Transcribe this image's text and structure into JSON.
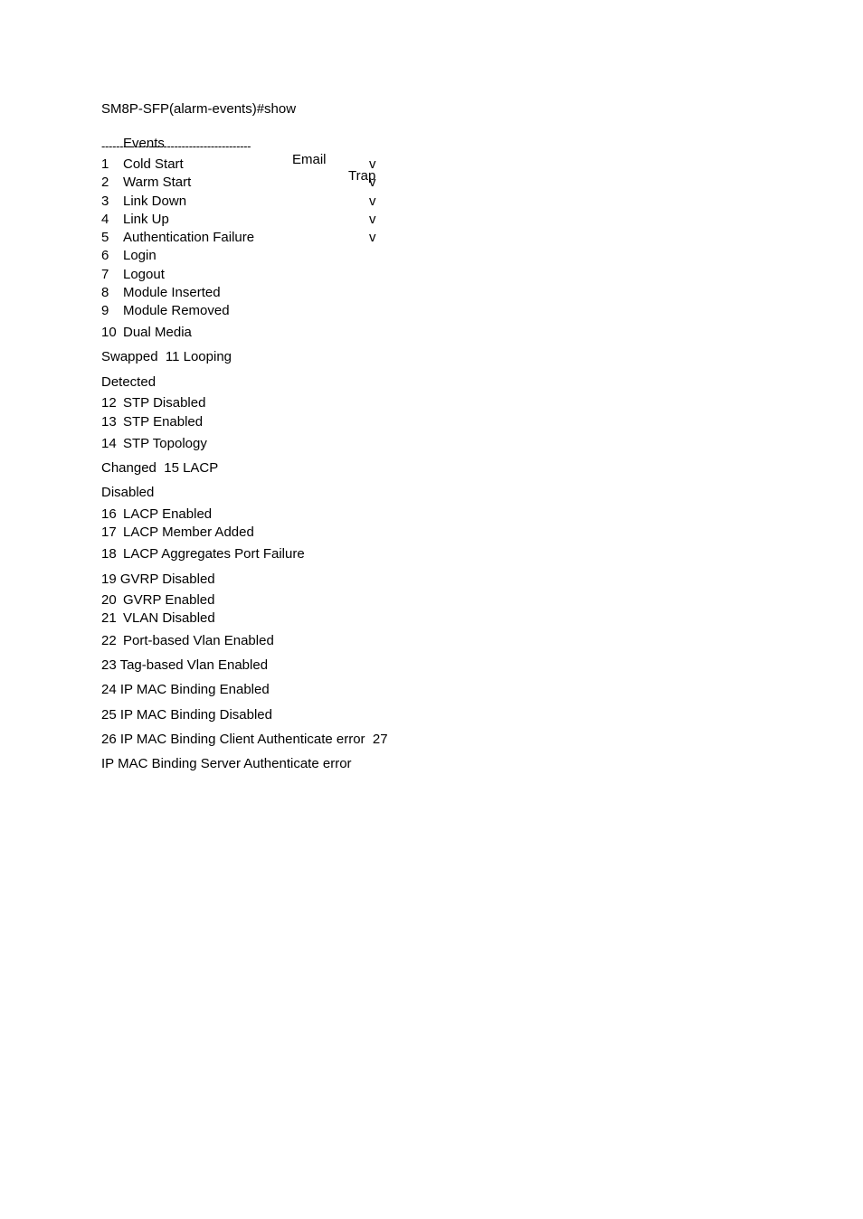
{
  "command": "SM8P-SFP(alarm-events)#show",
  "header": {
    "events": "Events",
    "email": "Email",
    "trap": "Trap"
  },
  "separator": "-----------------------------------------",
  "lines": [
    {
      "num": "1",
      "text": "Cold Start",
      "trap": "v"
    },
    {
      "num": "2",
      "text": "Warm Start",
      "trap": "v"
    },
    {
      "num": "3",
      "text": "Link Down",
      "trap": "v"
    },
    {
      "num": "4",
      "text": "Link Up",
      "trap": "v"
    },
    {
      "num": "5",
      "text": "Authentication Failure",
      "trap": "v"
    },
    {
      "num": "6",
      "text": "Login",
      "trap": ""
    },
    {
      "num": "7",
      "text": "Logout",
      "trap": ""
    },
    {
      "num": "8",
      "text": "Module Inserted",
      "trap": ""
    },
    {
      "num": "9",
      "text": "Module Removed",
      "trap": ""
    },
    {
      "num": "10",
      "text": "Dual Media",
      "trap": ""
    },
    {
      "num": "",
      "text": "Swapped  11 Looping",
      "trap": ""
    },
    {
      "num": "",
      "text": "Detected",
      "trap": ""
    },
    {
      "num": "12",
      "text": "STP Disabled",
      "trap": ""
    },
    {
      "num": "13",
      "text": "STP Enabled",
      "trap": ""
    },
    {
      "num": "14",
      "text": "STP Topology",
      "trap": ""
    },
    {
      "num": "",
      "text": "Changed  15 LACP",
      "trap": ""
    },
    {
      "num": "",
      "text": "Disabled",
      "trap": ""
    },
    {
      "num": "16",
      "text": "LACP Enabled",
      "trap": ""
    },
    {
      "num": "17",
      "text": "LACP Member Added",
      "trap": ""
    },
    {
      "num": "18",
      "text": "LACP Aggregates Port Failure",
      "trap": ""
    },
    {
      "num": "",
      "text": "19 GVRP Disabled",
      "trap": ""
    },
    {
      "num": "20",
      "text": "GVRP Enabled",
      "trap": ""
    },
    {
      "num": "21",
      "text": "VLAN Disabled",
      "trap": ""
    },
    {
      "num": "22",
      "text": "Port-based Vlan Enabled",
      "trap": ""
    },
    {
      "num": "",
      "text": "23 Tag-based Vlan Enabled",
      "trap": ""
    },
    {
      "num": "",
      "text": "24 IP MAC Binding Enabled",
      "trap": ""
    },
    {
      "num": "",
      "text": "25 IP MAC Binding Disabled",
      "trap": ""
    },
    {
      "num": "",
      "text": "26 IP MAC Binding Client Authenticate error  27",
      "trap": ""
    },
    {
      "num": "",
      "text": "IP MAC Binding Server Authenticate error",
      "trap": ""
    }
  ]
}
